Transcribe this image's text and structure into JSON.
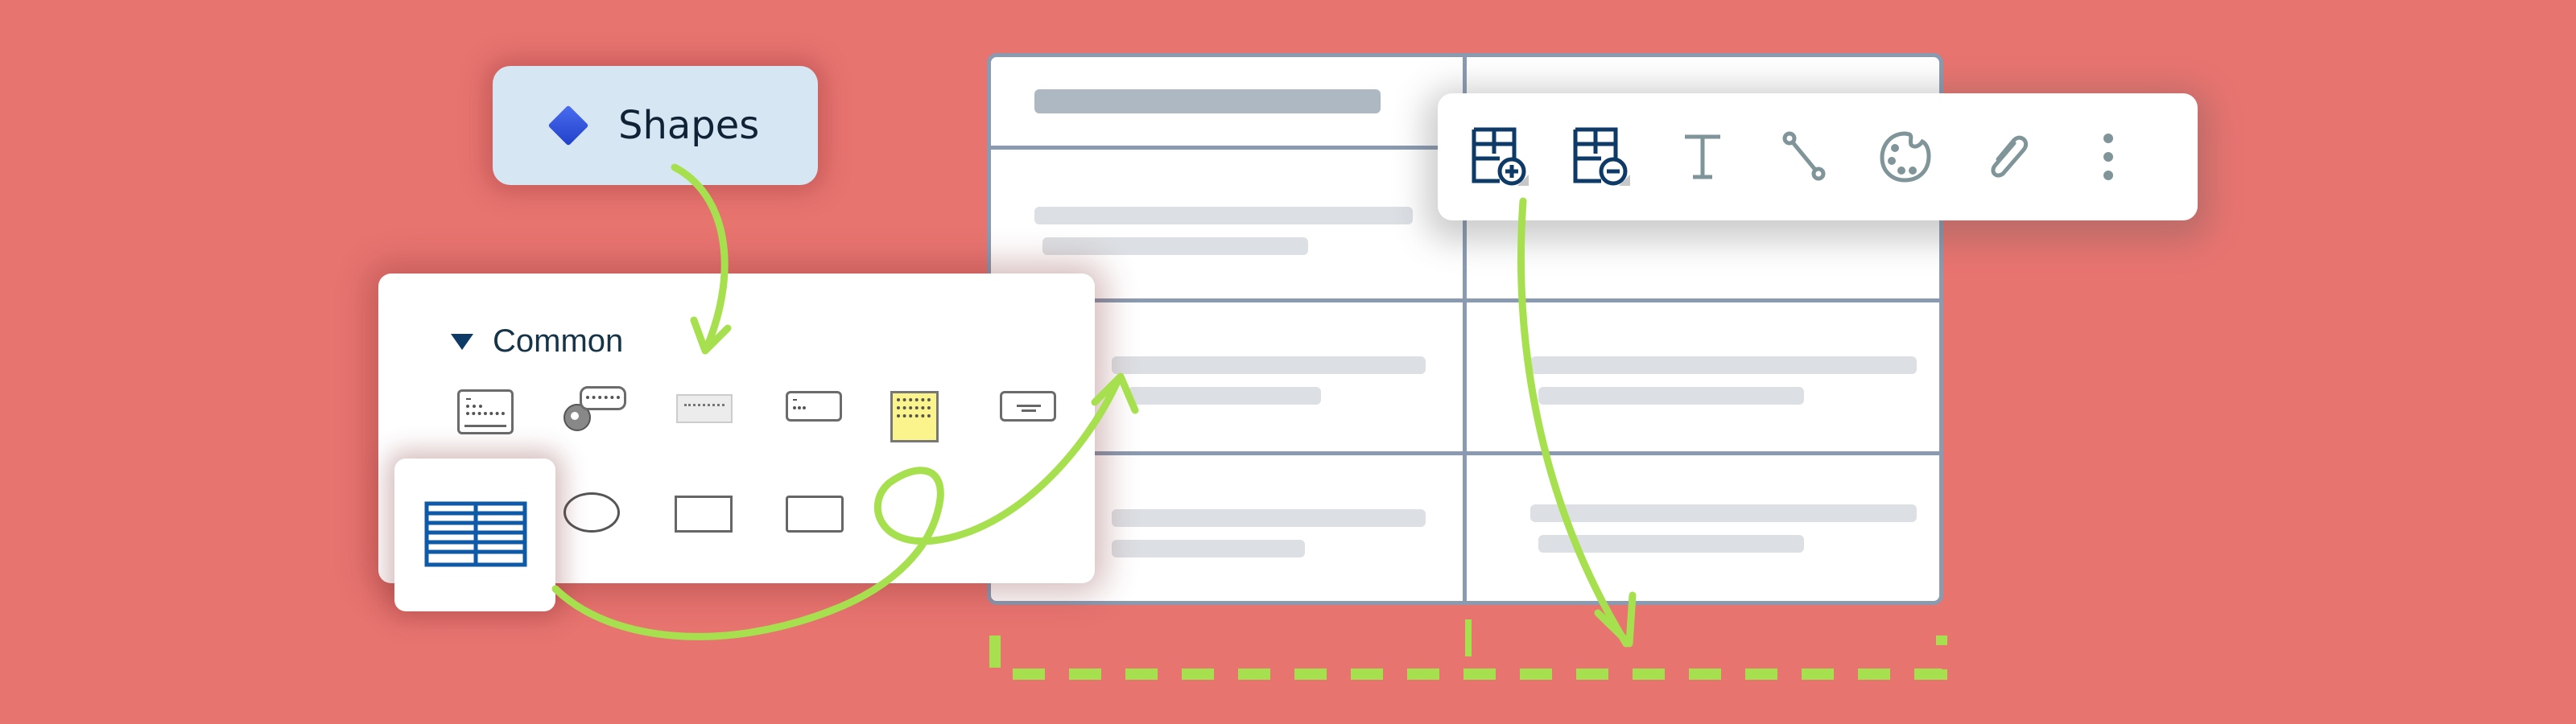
{
  "shapes_pill": {
    "label": "Shapes",
    "icon": "diamond-icon"
  },
  "common_panel": {
    "section_label": "Common",
    "expanded": true,
    "shapes_row1": [
      "text-block",
      "comment-callout",
      "caption-note",
      "text-note",
      "sticky-note",
      "button-shape"
    ],
    "shapes_row2": [
      "table",
      "ellipse",
      "rectangle",
      "rounded-rectangle"
    ],
    "selected_shape": "table"
  },
  "toolbar": {
    "items": [
      {
        "name": "add-row-column",
        "icon": "table-add-icon"
      },
      {
        "name": "remove-row-column",
        "icon": "table-remove-icon"
      },
      {
        "name": "text",
        "icon": "text-icon"
      },
      {
        "name": "connector",
        "icon": "connector-icon"
      },
      {
        "name": "style",
        "icon": "palette-icon"
      },
      {
        "name": "link",
        "icon": "paperclip-link-icon"
      },
      {
        "name": "more",
        "icon": "more-vertical-icon"
      }
    ]
  },
  "colors": {
    "background": "#e87470",
    "accent_arrow": "#a7e04f",
    "pill_bg": "#d6e6f2",
    "table_border": "#8a9ab0",
    "icon_dark": "#0d3a66",
    "icon_gray": "#7f9599",
    "sticky_yellow": "#fbf38c"
  }
}
